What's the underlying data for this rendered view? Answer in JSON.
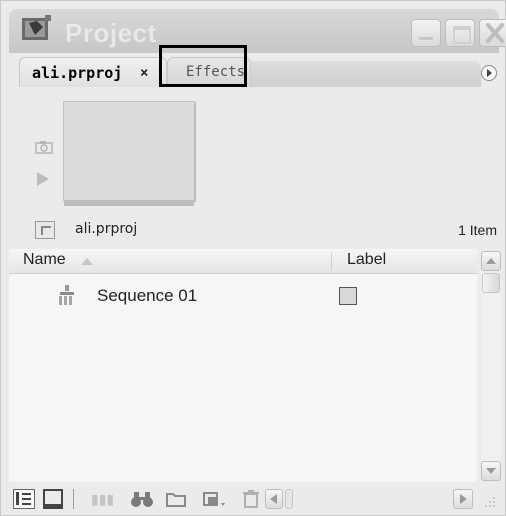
{
  "window": {
    "title": "Project"
  },
  "tabs": [
    {
      "label": "ali.prproj",
      "close_glyph": "×",
      "active": true
    },
    {
      "label": "Effects",
      "active": false
    }
  ],
  "path": {
    "label": "ali.prproj",
    "item_count": "1 Item"
  },
  "list": {
    "columns": [
      "Name",
      "Label"
    ],
    "rows": [
      {
        "name": "Sequence 01",
        "label_color": "#d9d9d9"
      }
    ]
  },
  "icons": {
    "app": "project-film-icon",
    "set_poster": "camera-icon",
    "play": "play-icon",
    "up": "parent-folder-icon",
    "sequence": "sequence-icon",
    "list_view": "list-view-icon",
    "icon_view": "icon-view-icon",
    "automate": "automate-to-sequence-icon",
    "find": "find-binoculars-icon",
    "new_bin": "folder-icon",
    "new_item": "new-item-icon",
    "clear": "trash-icon"
  },
  "colors": {
    "panel_bg": "#ecebe9",
    "highlight_border": "#000000"
  }
}
